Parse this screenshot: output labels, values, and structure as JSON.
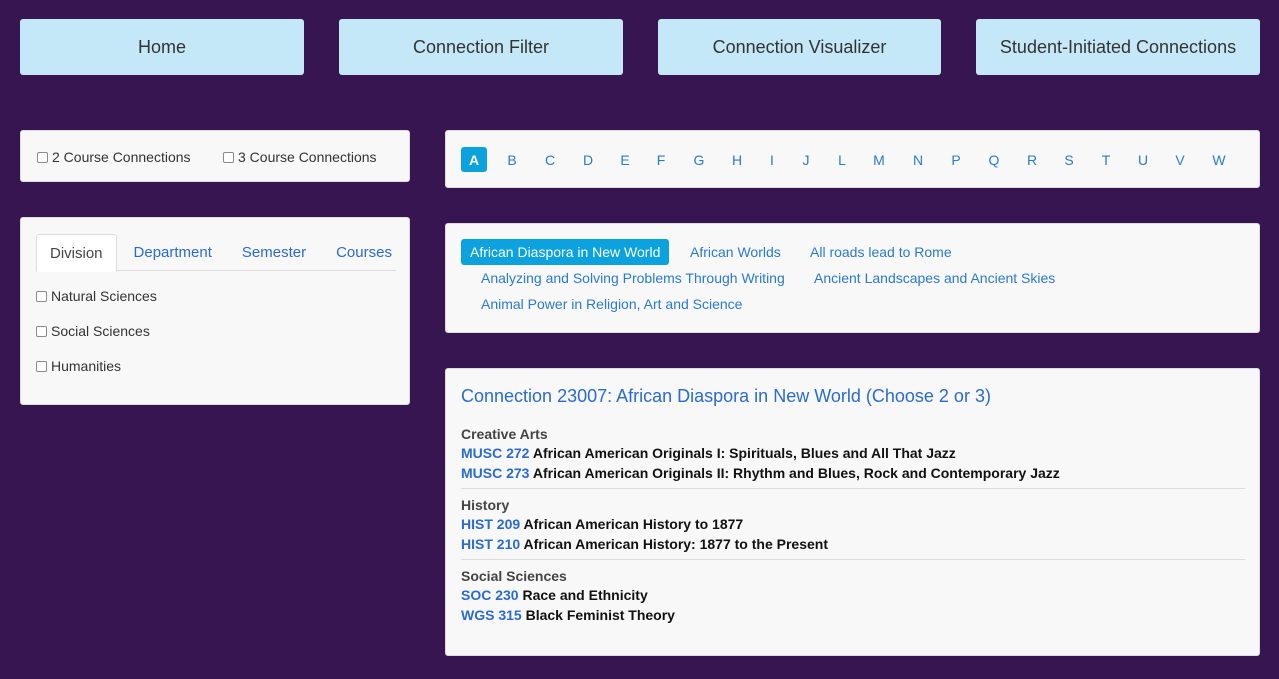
{
  "nav": {
    "home": "Home",
    "filter": "Connection Filter",
    "visualizer": "Connection Visualizer",
    "student": "Student-Initiated Connections"
  },
  "course_count": {
    "two": "2 Course Connections",
    "three": "3 Course Connections"
  },
  "filter_tabs": {
    "division": "Division",
    "department": "Department",
    "semester": "Semester",
    "courses": "Courses"
  },
  "divisions": [
    "Natural Sciences",
    "Social Sciences",
    "Humanities"
  ],
  "letters": [
    "A",
    "B",
    "C",
    "D",
    "E",
    "F",
    "G",
    "H",
    "I",
    "J",
    "L",
    "M",
    "N",
    "P",
    "Q",
    "R",
    "S",
    "T",
    "U",
    "V",
    "W"
  ],
  "connections": [
    "African Diaspora in New World",
    "African Worlds",
    "All roads lead to Rome",
    "Analyzing and Solving Problems Through Writing",
    "Ancient Landscapes and Ancient Skies",
    "Animal Power in Religion, Art and Science"
  ],
  "detail": {
    "title": "Connection 23007: African Diaspora in New World (Choose 2 or 3)",
    "groups": [
      {
        "name": "Creative Arts",
        "courses": [
          {
            "code": "MUSC 272",
            "title": "African American Originals I: Spirituals, Blues and All That Jazz"
          },
          {
            "code": "MUSC 273",
            "title": "African American Originals II: Rhythm and Blues, Rock and Contemporary Jazz"
          }
        ]
      },
      {
        "name": "History",
        "courses": [
          {
            "code": "HIST 209",
            "title": "African American History to 1877"
          },
          {
            "code": "HIST 210",
            "title": "African American History: 1877 to the Present"
          }
        ]
      },
      {
        "name": "Social Sciences",
        "courses": [
          {
            "code": "SOC 230",
            "title": "Race and Ethnicity"
          },
          {
            "code": "WGS 315",
            "title": "Black Feminist Theory"
          }
        ]
      }
    ]
  }
}
